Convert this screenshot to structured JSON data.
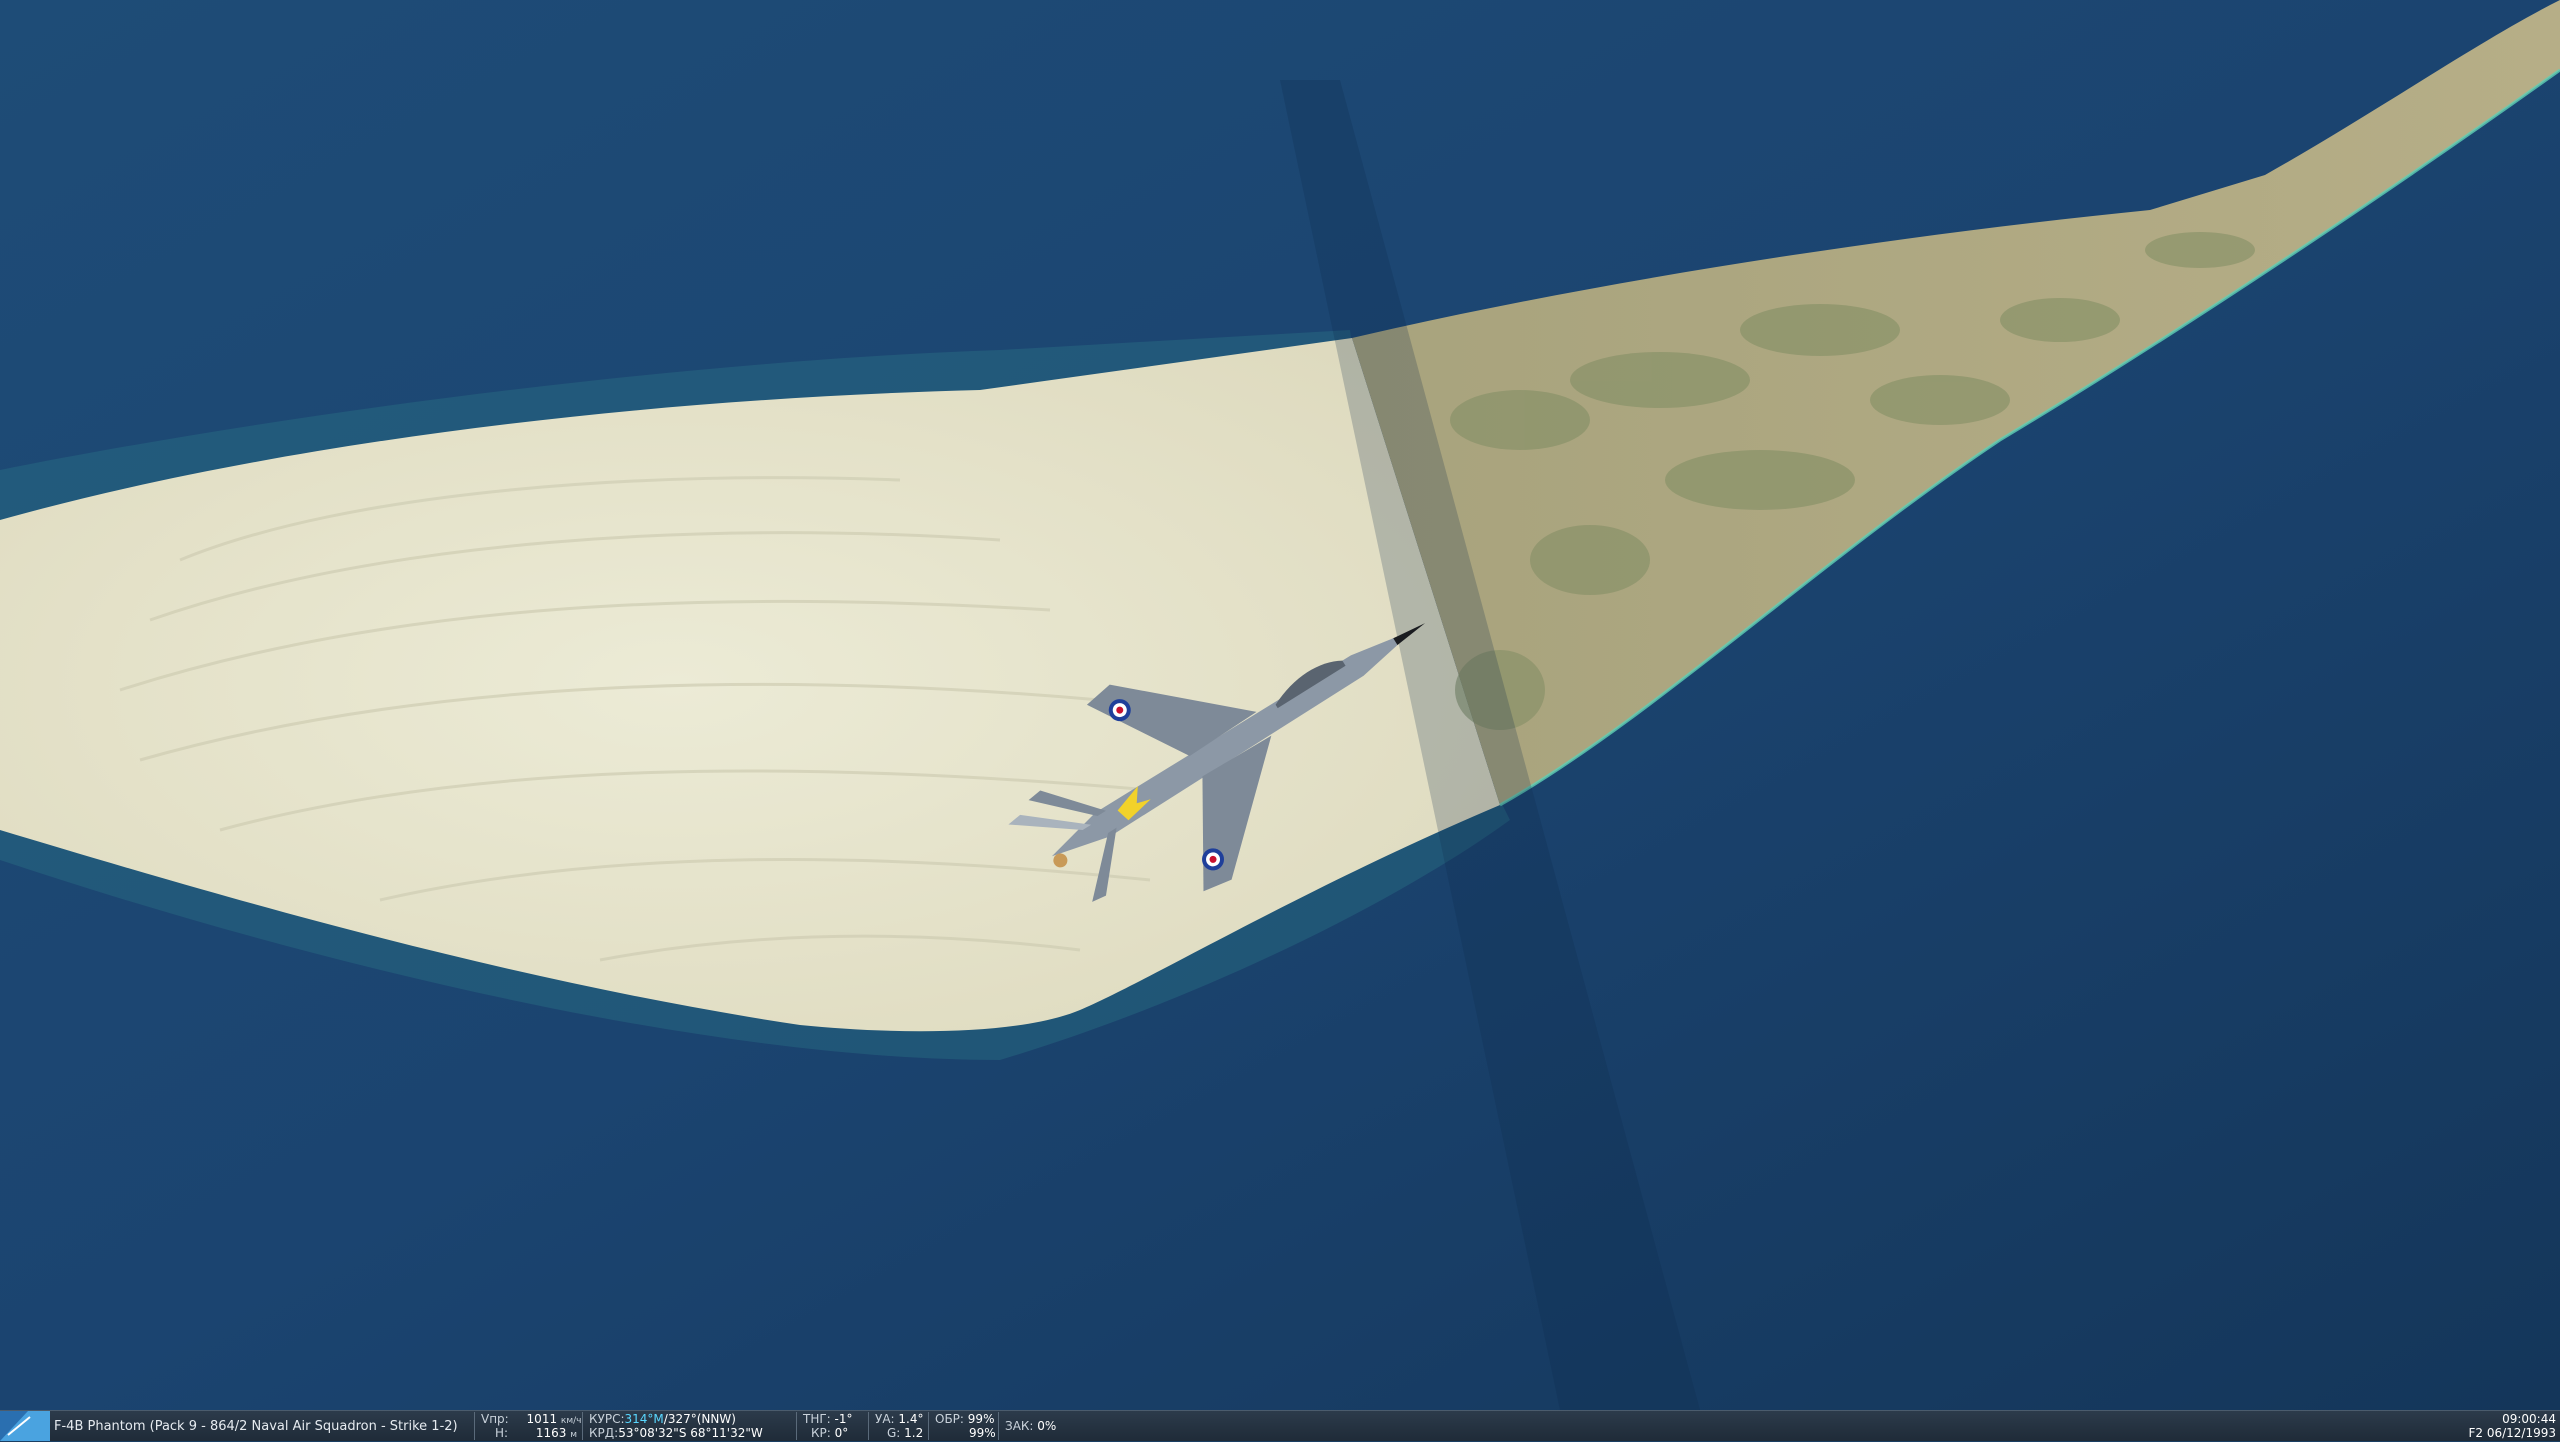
{
  "unit": {
    "title": "F-4B Phantom (Pack 9 - 864/2 Naval Air Squadron - Strike 1-2)"
  },
  "speed": {
    "label": "Vпр:",
    "value": "1011",
    "unit": "км/ч"
  },
  "altitude": {
    "label": "H:",
    "value": "1163",
    "unit": "м"
  },
  "heading": {
    "label": "КУРС:",
    "magnetic": "314°M",
    "separator": "/",
    "true": "327°(NNW)"
  },
  "coords": {
    "label": "КРД:",
    "value": "53°08'32\"S 68°11'32\"W"
  },
  "thrust": {
    "label": "ТНГ:",
    "value": "-1°"
  },
  "roll": {
    "label": "КР:",
    "value": "0°"
  },
  "aoa": {
    "label": "УА:",
    "value": "1.4°"
  },
  "gload": {
    "label": "G:",
    "value": "1.2"
  },
  "rpm": {
    "label": "ОБР:",
    "value1": "99%",
    "value2": "99%"
  },
  "flaps": {
    "label": "ЗАК:",
    "value": "0%"
  },
  "clock": {
    "time": "09:00:44",
    "date": "F2 06/12/1993"
  },
  "colors": {
    "sea": "#1b3f63",
    "sand": "#e8e6cf",
    "grass": "#a9a47c",
    "statusbar": "#26323f",
    "highlight": "#59d7ff"
  },
  "aircraft": {
    "roundel_colors": [
      "#1f3f9a",
      "#ffffff",
      "#c8102e"
    ]
  }
}
